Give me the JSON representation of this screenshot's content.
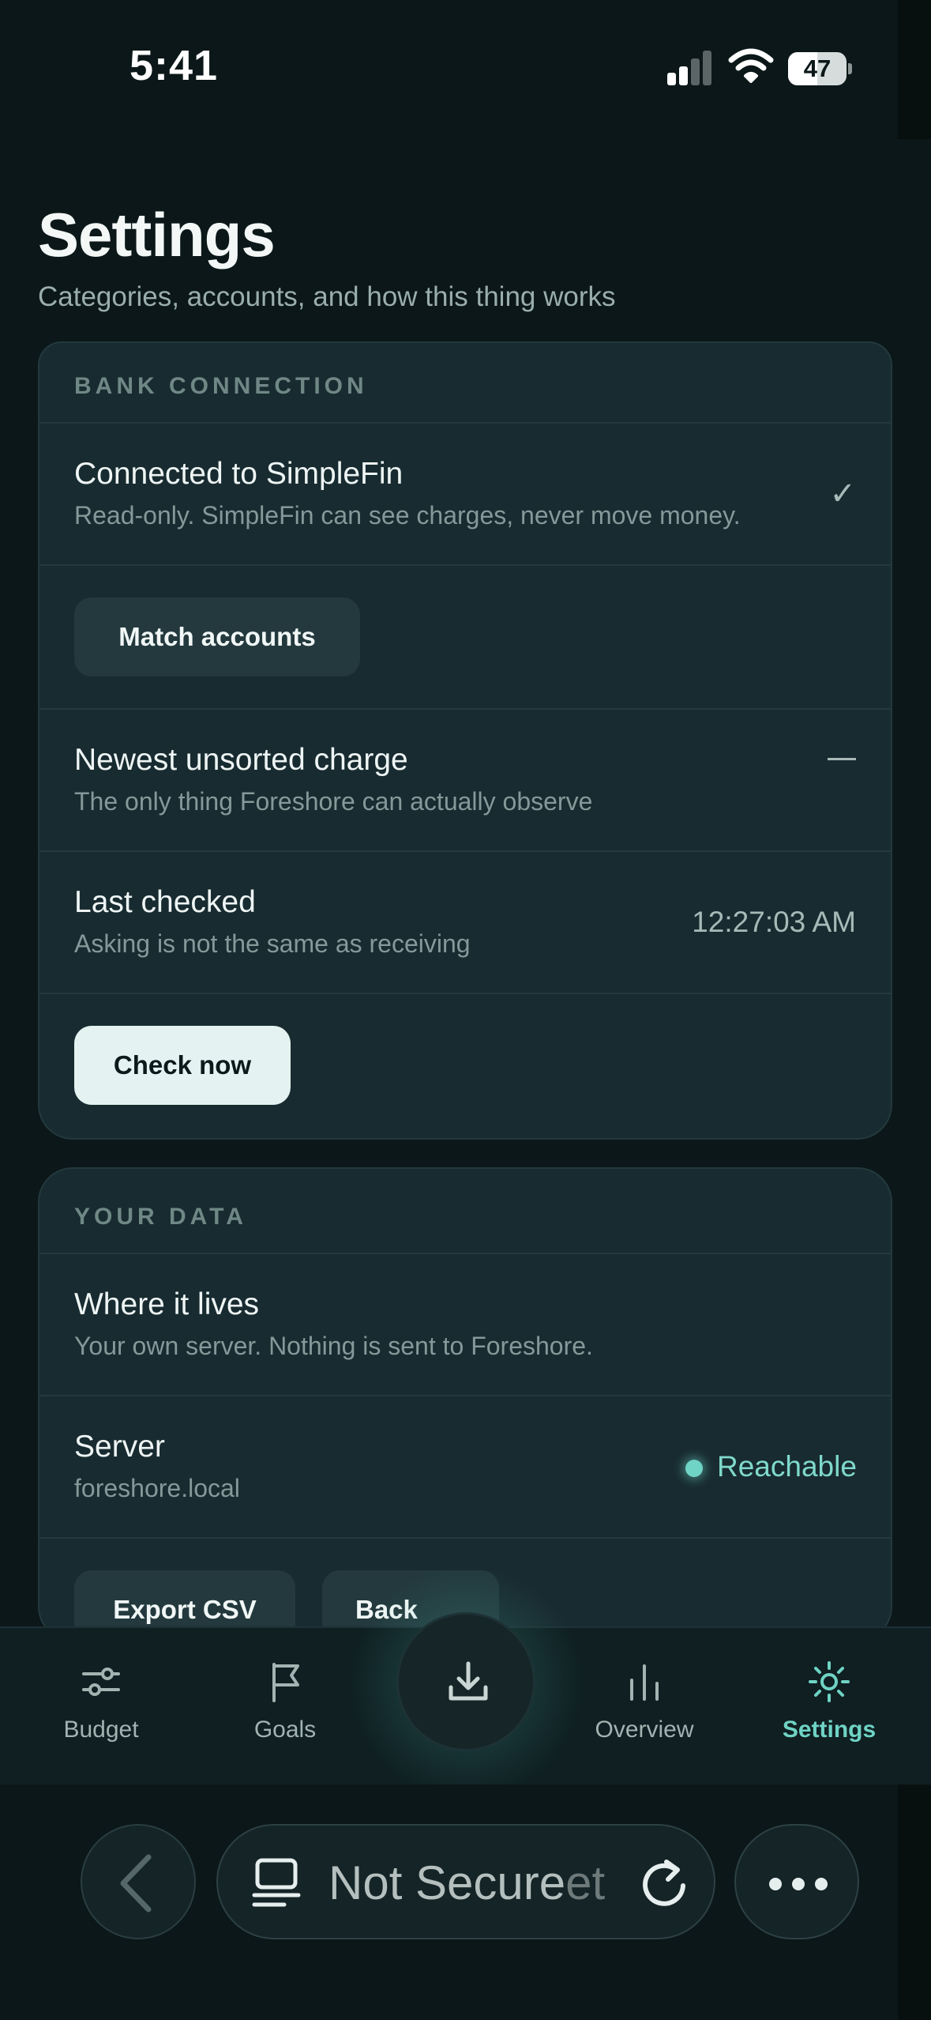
{
  "status_bar": {
    "time": "5:41",
    "battery_level": "47"
  },
  "header": {
    "title": "Settings",
    "subtitle": "Categories, accounts, and how this thing works"
  },
  "bank_connection": {
    "section_label": "BANK CONNECTION",
    "connected_title": "Connected to SimpleFin",
    "connected_sub": "Read-only. SimpleFin can see charges, never move money.",
    "connected_icon": "check-icon",
    "match_button": "Match accounts",
    "newest_title": "Newest unsorted charge",
    "newest_sub": "The only thing Foreshore can actually observe",
    "newest_value_icon": "dash-icon",
    "last_checked_title": "Last checked",
    "last_checked_sub": "Asking is not the same as receiving",
    "last_checked_value": "12:27:03 AM",
    "check_button": "Check now"
  },
  "your_data": {
    "section_label": "YOUR DATA",
    "where_title": "Where it lives",
    "where_sub": "Your own server. Nothing is sent to Foreshore.",
    "server_title": "Server",
    "server_sub": "foreshore.local",
    "server_status": "Reachable",
    "server_status_color": "#6fd3c5",
    "export_button": "Export CSV",
    "backup_button": "Back"
  },
  "tabs": [
    {
      "label": "Budget",
      "icon": "sliders-icon",
      "active": false
    },
    {
      "label": "Goals",
      "icon": "flag-icon",
      "active": false
    },
    {
      "label": "",
      "icon": "download-icon",
      "active": false
    },
    {
      "label": "Overview",
      "icon": "bar-chart-icon",
      "active": false
    },
    {
      "label": "Settings",
      "icon": "gear-icon",
      "active": true
    }
  ],
  "browser": {
    "url_text": "Not Secure",
    "url_overlap_text": "et"
  },
  "colors": {
    "accent": "#6fd3c5",
    "background": "#0b1718",
    "card": "#182b30"
  }
}
